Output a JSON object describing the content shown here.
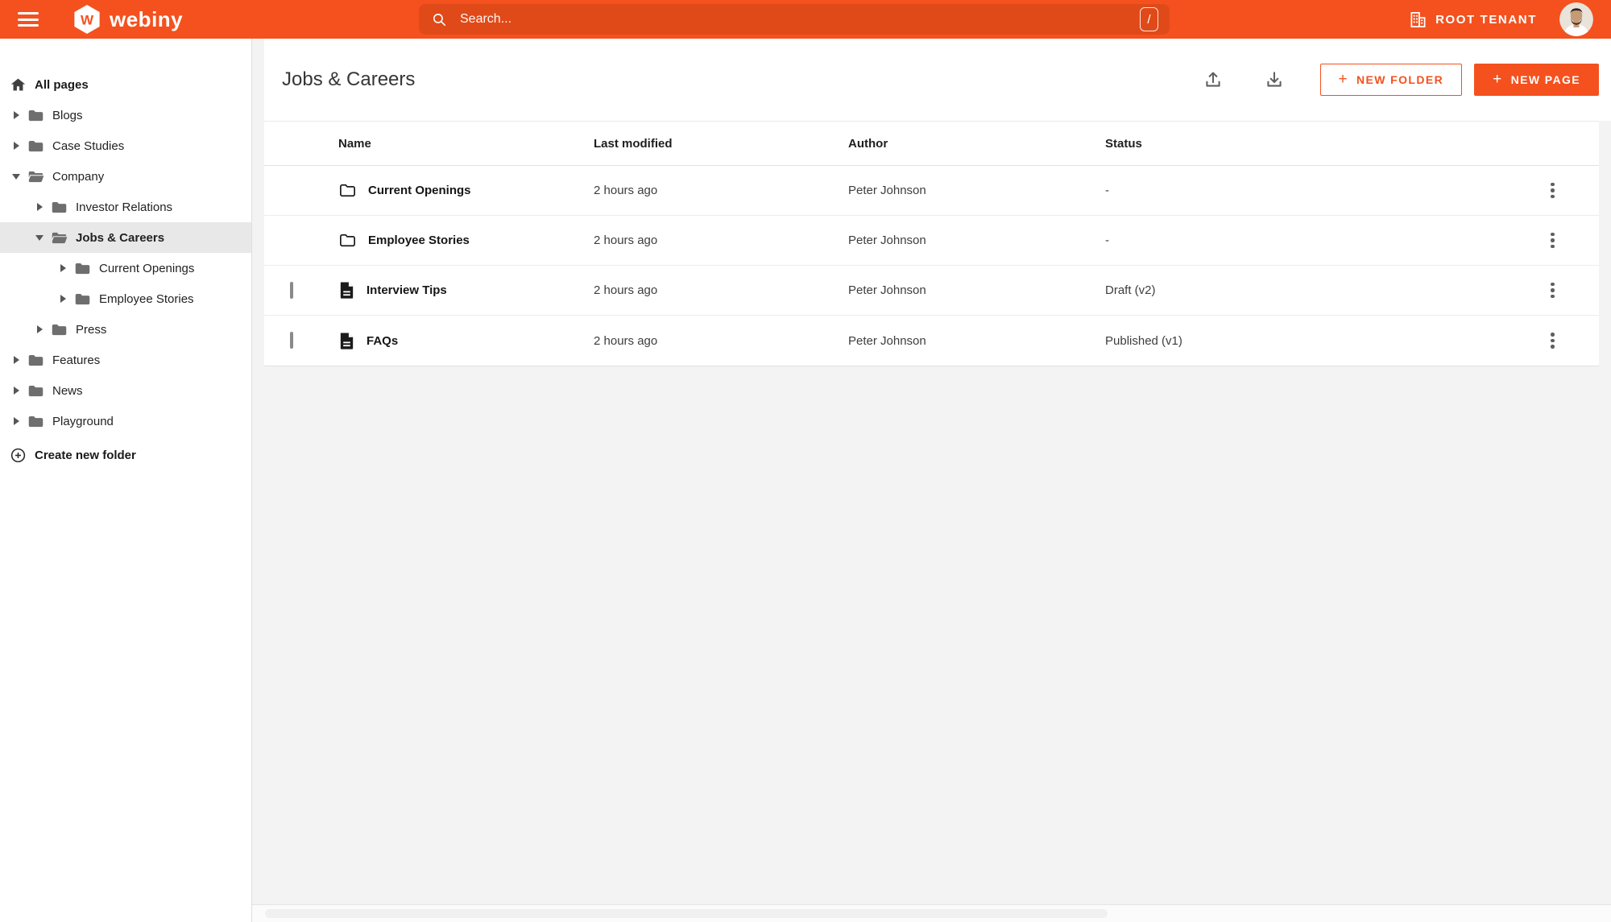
{
  "topbar": {
    "brand": "webiny",
    "search": {
      "placeholder": "Search...",
      "shortcut": "/"
    },
    "tenant": "ROOT TENANT",
    "icons": {
      "menu": "hamburger",
      "search": "magnifier",
      "tenant": "building",
      "user": "avatar-photo"
    }
  },
  "colors": {
    "primary": "#f4511e",
    "primary_dark": "#e04a19",
    "checkbox_teal": "#00ccb0",
    "selected_row_bg": "#e8e8e8"
  },
  "sidebar": {
    "root": "All pages",
    "items": [
      {
        "label": "Blogs",
        "level": 0,
        "state": "collapsed",
        "selected": false
      },
      {
        "label": "Case Studies",
        "level": 0,
        "state": "collapsed",
        "selected": false
      },
      {
        "label": "Company",
        "level": 0,
        "state": "expanded",
        "selected": false
      },
      {
        "label": "Investor Relations",
        "level": 1,
        "state": "collapsed",
        "selected": false
      },
      {
        "label": "Jobs & Careers",
        "level": 1,
        "state": "expanded",
        "selected": true
      },
      {
        "label": "Current Openings",
        "level": 2,
        "state": "collapsed",
        "selected": false
      },
      {
        "label": "Employee Stories",
        "level": 2,
        "state": "collapsed",
        "selected": false
      },
      {
        "label": "Press",
        "level": 1,
        "state": "collapsed",
        "selected": false
      },
      {
        "label": "Features",
        "level": 0,
        "state": "collapsed",
        "selected": false
      },
      {
        "label": "News",
        "level": 0,
        "state": "collapsed",
        "selected": false
      },
      {
        "label": "Playground",
        "level": 0,
        "state": "collapsed",
        "selected": false
      }
    ],
    "create_folder": "Create new folder"
  },
  "main": {
    "title": "Jobs & Careers",
    "buttons": {
      "new_folder": "NEW FOLDER",
      "new_page": "NEW PAGE",
      "plus": "+"
    },
    "header_icons": {
      "upload": "arrow-up-tray",
      "download": "arrow-down-tray"
    },
    "table": {
      "header_checkbox": "indeterminate",
      "columns": [
        "Name",
        "Last modified",
        "Author",
        "Status"
      ],
      "rows": [
        {
          "type": "folder",
          "name": "Current Openings",
          "modified": "2 hours ago",
          "author": "Peter Johnson",
          "status": "-"
        },
        {
          "type": "folder",
          "name": "Employee Stories",
          "modified": "2 hours ago",
          "author": "Peter Johnson",
          "status": "-"
        },
        {
          "type": "page",
          "name": "Interview Tips",
          "modified": "2 hours ago",
          "author": "Peter Johnson",
          "status": "Draft (v2)"
        },
        {
          "type": "page",
          "name": "FAQs",
          "modified": "2 hours ago",
          "author": "Peter Johnson",
          "status": "Published (v1)"
        }
      ],
      "row_menu_icon": "kebab-vertical"
    }
  }
}
